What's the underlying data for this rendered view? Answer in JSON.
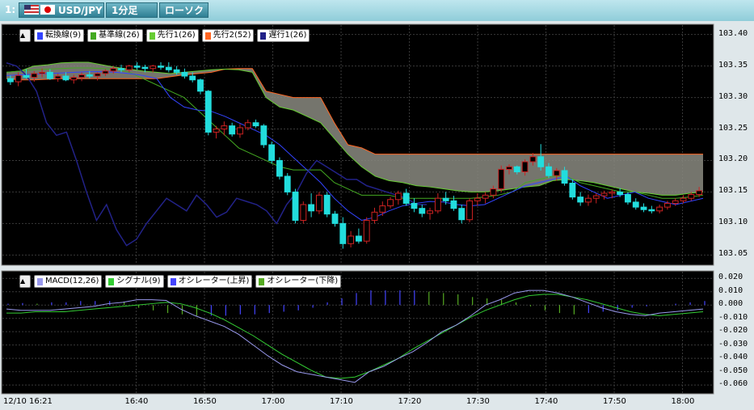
{
  "toolbar": {
    "index": "1:",
    "symbol": "USD/JPY",
    "timeframe": "1分足",
    "chart_type": "ローソク"
  },
  "legend_main": [
    {
      "label": "転換線(9)",
      "color": "#3344ff"
    },
    {
      "label": "基準線(26)",
      "color": "#44aa22"
    },
    {
      "label": "先行1(26)",
      "color": "#66cc33"
    },
    {
      "label": "先行2(52)",
      "color": "#ff6622"
    },
    {
      "label": "遅行1(26)",
      "color": "#222288"
    }
  ],
  "legend_macd": [
    {
      "label": "MACD(12,26)",
      "color": "#9999ee"
    },
    {
      "label": "シグナル(9)",
      "color": "#33cc33"
    },
    {
      "label": "オシレーター(上昇)",
      "color": "#4444ff"
    },
    {
      "label": "オシレーター(下降)",
      "color": "#55aa22"
    }
  ],
  "colors": {
    "up": "#cc2222",
    "down": "#22dddd",
    "cloud": "#8a8a80"
  },
  "chart_data": [
    {
      "type": "candlestick",
      "title": "USD/JPY 1分足",
      "y_ticks": [
        "103.40",
        "103.35",
        "103.30",
        "103.25",
        "103.20",
        "103.15",
        "103.10",
        "103.05"
      ],
      "ylim": [
        103.035,
        103.415
      ],
      "x_ticks": [
        "12/10 16:21",
        "16:40",
        "16:50",
        "17:00",
        "17:10",
        "17:20",
        "17:30",
        "17:40",
        "17:50",
        "18:00"
      ],
      "x_tick_minutes": [
        0,
        19,
        29,
        39,
        49,
        59,
        69,
        79,
        89,
        99
      ],
      "candles": [
        [
          103.33,
          103.335,
          103.32,
          103.325
        ],
        [
          103.325,
          103.34,
          103.318,
          103.335
        ],
        [
          103.335,
          103.345,
          103.33,
          103.332
        ],
        [
          103.332,
          103.342,
          103.325,
          103.338
        ],
        [
          103.338,
          103.346,
          103.332,
          103.34
        ],
        [
          103.34,
          103.345,
          103.328,
          103.33
        ],
        [
          103.33,
          103.338,
          103.325,
          103.334
        ],
        [
          103.334,
          103.34,
          103.326,
          103.328
        ],
        [
          103.328,
          103.336,
          103.322,
          103.332
        ],
        [
          103.332,
          103.34,
          103.326,
          103.336
        ],
        [
          103.336,
          103.342,
          103.33,
          103.334
        ],
        [
          103.334,
          103.34,
          103.327,
          103.338
        ],
        [
          103.338,
          103.345,
          103.334,
          103.342
        ],
        [
          103.342,
          103.35,
          103.338,
          103.346
        ],
        [
          103.346,
          103.352,
          103.34,
          103.344
        ],
        [
          103.344,
          103.352,
          103.34,
          103.35
        ],
        [
          103.35,
          103.356,
          103.344,
          103.348
        ],
        [
          103.348,
          103.352,
          103.34,
          103.346
        ],
        [
          103.346,
          103.352,
          103.34,
          103.35
        ],
        [
          103.35,
          103.356,
          103.344,
          103.348
        ],
        [
          103.348,
          103.356,
          103.34,
          103.344
        ],
        [
          103.344,
          103.35,
          103.336,
          103.34
        ],
        [
          103.34,
          103.346,
          103.33,
          103.334
        ],
        [
          103.334,
          103.34,
          103.324,
          103.328
        ],
        [
          103.328,
          103.33,
          103.305,
          103.31
        ],
        [
          103.31,
          103.312,
          103.24,
          103.245
        ],
        [
          103.245,
          103.255,
          103.235,
          103.25
        ],
        [
          103.25,
          103.262,
          103.24,
          103.255
        ],
        [
          103.255,
          103.26,
          103.238,
          103.242
        ],
        [
          103.242,
          103.258,
          103.236,
          103.252
        ],
        [
          103.252,
          103.265,
          103.248,
          103.26
        ],
        [
          103.26,
          103.265,
          103.252,
          103.255
        ],
        [
          103.255,
          103.258,
          103.22,
          103.225
        ],
        [
          103.225,
          103.23,
          103.195,
          103.2
        ],
        [
          103.2,
          103.205,
          103.17,
          103.175
        ],
        [
          103.175,
          103.18,
          103.145,
          103.15
        ],
        [
          103.15,
          103.155,
          103.1,
          103.105
        ],
        [
          103.105,
          103.135,
          103.1,
          103.13
        ],
        [
          103.13,
          103.148,
          103.11,
          103.12
        ],
        [
          103.12,
          103.15,
          103.115,
          103.145
        ],
        [
          103.145,
          103.15,
          103.11,
          103.115
        ],
        [
          103.115,
          103.12,
          103.095,
          103.1
        ],
        [
          103.1,
          103.11,
          103.06,
          103.068
        ],
        [
          103.068,
          103.088,
          103.062,
          103.08
        ],
        [
          103.08,
          103.092,
          103.068,
          103.072
        ],
        [
          103.072,
          103.11,
          103.068,
          103.105
        ],
        [
          103.105,
          103.125,
          103.1,
          103.118
        ],
        [
          103.118,
          103.135,
          103.112,
          103.128
        ],
        [
          103.128,
          103.142,
          103.124,
          103.138
        ],
        [
          103.138,
          103.152,
          103.13,
          103.148
        ],
        [
          103.148,
          103.155,
          103.128,
          103.132
        ],
        [
          103.132,
          103.14,
          103.118,
          103.124
        ],
        [
          103.124,
          103.13,
          103.11,
          103.116
        ],
        [
          103.116,
          103.125,
          103.106,
          103.12
        ],
        [
          103.12,
          103.148,
          103.116,
          103.14
        ],
        [
          103.14,
          103.15,
          103.13,
          103.136
        ],
        [
          103.136,
          103.144,
          103.12,
          103.124
        ],
        [
          103.124,
          103.13,
          103.1,
          103.106
        ],
        [
          103.106,
          103.14,
          103.102,
          103.136
        ],
        [
          103.136,
          103.148,
          103.128,
          103.14
        ],
        [
          103.14,
          103.15,
          103.132,
          103.145
        ],
        [
          103.145,
          103.16,
          103.14,
          103.155
        ],
        [
          103.155,
          103.192,
          103.15,
          103.186
        ],
        [
          103.186,
          103.194,
          103.178,
          103.19
        ],
        [
          103.19,
          103.192,
          103.178,
          103.182
        ],
        [
          103.182,
          103.202,
          103.176,
          103.198
        ],
        [
          103.198,
          103.212,
          103.192,
          103.206
        ],
        [
          103.206,
          103.226,
          103.184,
          103.19
        ],
        [
          103.19,
          103.196,
          103.172,
          103.176
        ],
        [
          103.176,
          103.188,
          103.168,
          103.184
        ],
        [
          103.184,
          103.19,
          103.16,
          103.164
        ],
        [
          103.164,
          103.17,
          103.138,
          103.142
        ],
        [
          103.142,
          103.15,
          103.128,
          103.134
        ],
        [
          103.134,
          103.146,
          103.128,
          103.14
        ],
        [
          103.14,
          103.148,
          103.132,
          103.144
        ],
        [
          103.144,
          103.152,
          103.138,
          103.148
        ],
        [
          103.148,
          103.154,
          103.14,
          103.15
        ],
        [
          103.15,
          103.156,
          103.142,
          103.146
        ],
        [
          103.146,
          103.15,
          103.13,
          103.134
        ],
        [
          103.134,
          103.14,
          103.122,
          103.126
        ],
        [
          103.126,
          103.132,
          103.118,
          103.122
        ],
        [
          103.122,
          103.128,
          103.116,
          103.12
        ],
        [
          103.12,
          103.13,
          103.116,
          103.126
        ],
        [
          103.126,
          103.136,
          103.122,
          103.132
        ],
        [
          103.132,
          103.14,
          103.128,
          103.136
        ],
        [
          103.136,
          103.145,
          103.132,
          103.14
        ],
        [
          103.14,
          103.15,
          103.136,
          103.146
        ],
        [
          103.146,
          103.158,
          103.142,
          103.152
        ]
      ],
      "tenkan": [
        103.335,
        103.336,
        103.337,
        103.338,
        103.339,
        103.34,
        103.341,
        103.341,
        103.34,
        103.338,
        103.335,
        103.33,
        103.3,
        103.285,
        103.28,
        103.278,
        103.27,
        103.26,
        103.25,
        103.24,
        103.225,
        103.205,
        103.185,
        103.165,
        103.14,
        103.12,
        103.105,
        103.11,
        103.12,
        103.128,
        103.132,
        103.135,
        103.134,
        103.13,
        103.128,
        103.13,
        103.14,
        103.15,
        103.16,
        103.165,
        103.17,
        103.175,
        103.16,
        103.15,
        103.14,
        103.145,
        103.15,
        103.14,
        103.135,
        103.13,
        103.135,
        103.14
      ],
      "kijun": [
        103.34,
        103.342,
        103.344,
        103.345,
        103.346,
        103.347,
        103.347,
        103.346,
        103.345,
        103.34,
        103.33,
        103.32,
        103.31,
        103.3,
        103.28,
        103.26,
        103.24,
        103.22,
        103.21,
        103.2,
        103.19,
        103.185,
        103.185,
        103.185,
        103.165,
        103.155,
        103.145,
        103.145,
        103.145,
        103.14,
        103.14,
        103.14,
        103.14,
        103.14,
        103.14,
        103.142,
        103.145,
        103.15,
        103.165,
        103.17,
        103.175,
        103.175,
        103.165,
        103.16,
        103.155,
        103.15,
        103.15,
        103.145,
        103.14,
        103.14,
        103.142,
        103.145
      ],
      "senkou1": [
        103.34,
        103.342,
        103.35,
        103.352,
        103.355,
        103.356,
        103.356,
        103.352,
        103.348,
        103.345,
        103.342,
        103.34,
        103.338,
        103.34,
        103.342,
        103.344,
        103.345,
        103.344,
        103.34,
        103.3,
        103.285,
        103.28,
        103.27,
        103.26,
        103.235,
        103.21,
        103.19,
        103.175,
        103.168,
        103.165,
        103.16,
        103.158,
        103.155,
        103.152,
        103.15,
        103.15,
        103.152,
        103.155,
        103.158,
        103.16,
        103.168,
        103.17,
        103.168,
        103.165,
        103.16,
        103.155,
        103.15,
        103.148,
        103.145,
        103.145,
        103.148,
        103.15
      ],
      "senkou2": [
        103.33,
        103.328,
        103.328,
        103.329,
        103.33,
        103.33,
        103.33,
        103.33,
        103.33,
        103.33,
        103.33,
        103.33,
        103.333,
        103.336,
        103.338,
        103.34,
        103.345,
        103.346,
        103.346,
        103.31,
        103.305,
        103.3,
        103.3,
        103.3,
        103.26,
        103.225,
        103.22,
        103.21,
        103.21,
        103.21,
        103.21,
        103.21,
        103.21,
        103.21,
        103.21,
        103.21,
        103.21,
        103.21,
        103.21,
        103.21,
        103.21,
        103.21,
        103.21,
        103.21,
        103.21,
        103.21,
        103.21,
        103.21,
        103.21,
        103.21,
        103.21,
        103.21
      ],
      "chikou": [
        103.355,
        103.35,
        103.335,
        103.31,
        103.26,
        103.24,
        103.245,
        103.2,
        103.15,
        103.105,
        103.13,
        103.09,
        103.065,
        103.075,
        103.1,
        103.12,
        103.14,
        103.13,
        103.12,
        103.145,
        103.13,
        103.11,
        103.118,
        103.14,
        103.135,
        103.13,
        103.12,
        103.1,
        103.13,
        103.15,
        103.18,
        103.2,
        103.19,
        103.18,
        103.17,
        103.17,
        103.16,
        103.155,
        103.15,
        103.145,
        103.14,
        103.13,
        103.13
      ]
    },
    {
      "type": "line+bar",
      "title": "MACD",
      "y_ticks": [
        "0.020",
        "0.010",
        "0.000",
        "-0.010",
        "-0.020",
        "-0.030",
        "-0.040",
        "-0.050",
        "-0.060"
      ],
      "ylim": [
        -0.066,
        0.025
      ],
      "macd": [
        -0.003,
        -0.004,
        -0.004,
        -0.004,
        -0.003,
        -0.002,
        -0.001,
        0.001,
        0.002,
        0.004,
        0.004,
        0.0035,
        -0.003,
        -0.008,
        -0.012,
        -0.016,
        -0.022,
        -0.03,
        -0.038,
        -0.045,
        -0.05,
        -0.052,
        -0.054,
        -0.056,
        -0.058,
        -0.05,
        -0.046,
        -0.04,
        -0.035,
        -0.028,
        -0.02,
        -0.015,
        -0.008,
        0.0,
        0.004,
        0.009,
        0.011,
        0.011,
        0.009,
        0.006,
        0.002,
        -0.002,
        -0.005,
        -0.007,
        -0.008,
        -0.006,
        -0.005,
        -0.004,
        -0.003
      ],
      "signal": [
        -0.006,
        -0.006,
        -0.005,
        -0.005,
        -0.005,
        -0.004,
        -0.003,
        -0.002,
        -0.001,
        0.0,
        0.001,
        0.002,
        0.001,
        -0.002,
        -0.006,
        -0.011,
        -0.017,
        -0.023,
        -0.03,
        -0.037,
        -0.043,
        -0.049,
        -0.054,
        -0.055,
        -0.054,
        -0.05,
        -0.045,
        -0.04,
        -0.033,
        -0.027,
        -0.021,
        -0.015,
        -0.009,
        -0.004,
        0.0,
        0.004,
        0.007,
        0.008,
        0.008,
        0.006,
        0.004,
        0.001,
        -0.002,
        -0.005,
        -0.007,
        -0.008,
        -0.007,
        -0.006,
        -0.005
      ],
      "oscillator": [
        0.001,
        0.0015,
        0.001,
        0.002,
        0.002,
        0.003,
        0.003,
        0.003,
        0.002,
        -0.002,
        -0.004,
        -0.006,
        -0.007,
        -0.008,
        -0.008,
        -0.008,
        -0.007,
        -0.007,
        -0.006,
        -0.005,
        -0.004,
        -0.002,
        0.002,
        0.005,
        0.009,
        0.011,
        0.011,
        0.011,
        0.011,
        0.01,
        0.009,
        0.008,
        0.006,
        0.005,
        0.004,
        0.002,
        -0.001,
        -0.004,
        -0.006,
        -0.007,
        -0.006,
        -0.005,
        -0.004,
        -0.002,
        -0.001,
        0.0,
        0.001,
        0.002,
        0.003
      ]
    }
  ]
}
